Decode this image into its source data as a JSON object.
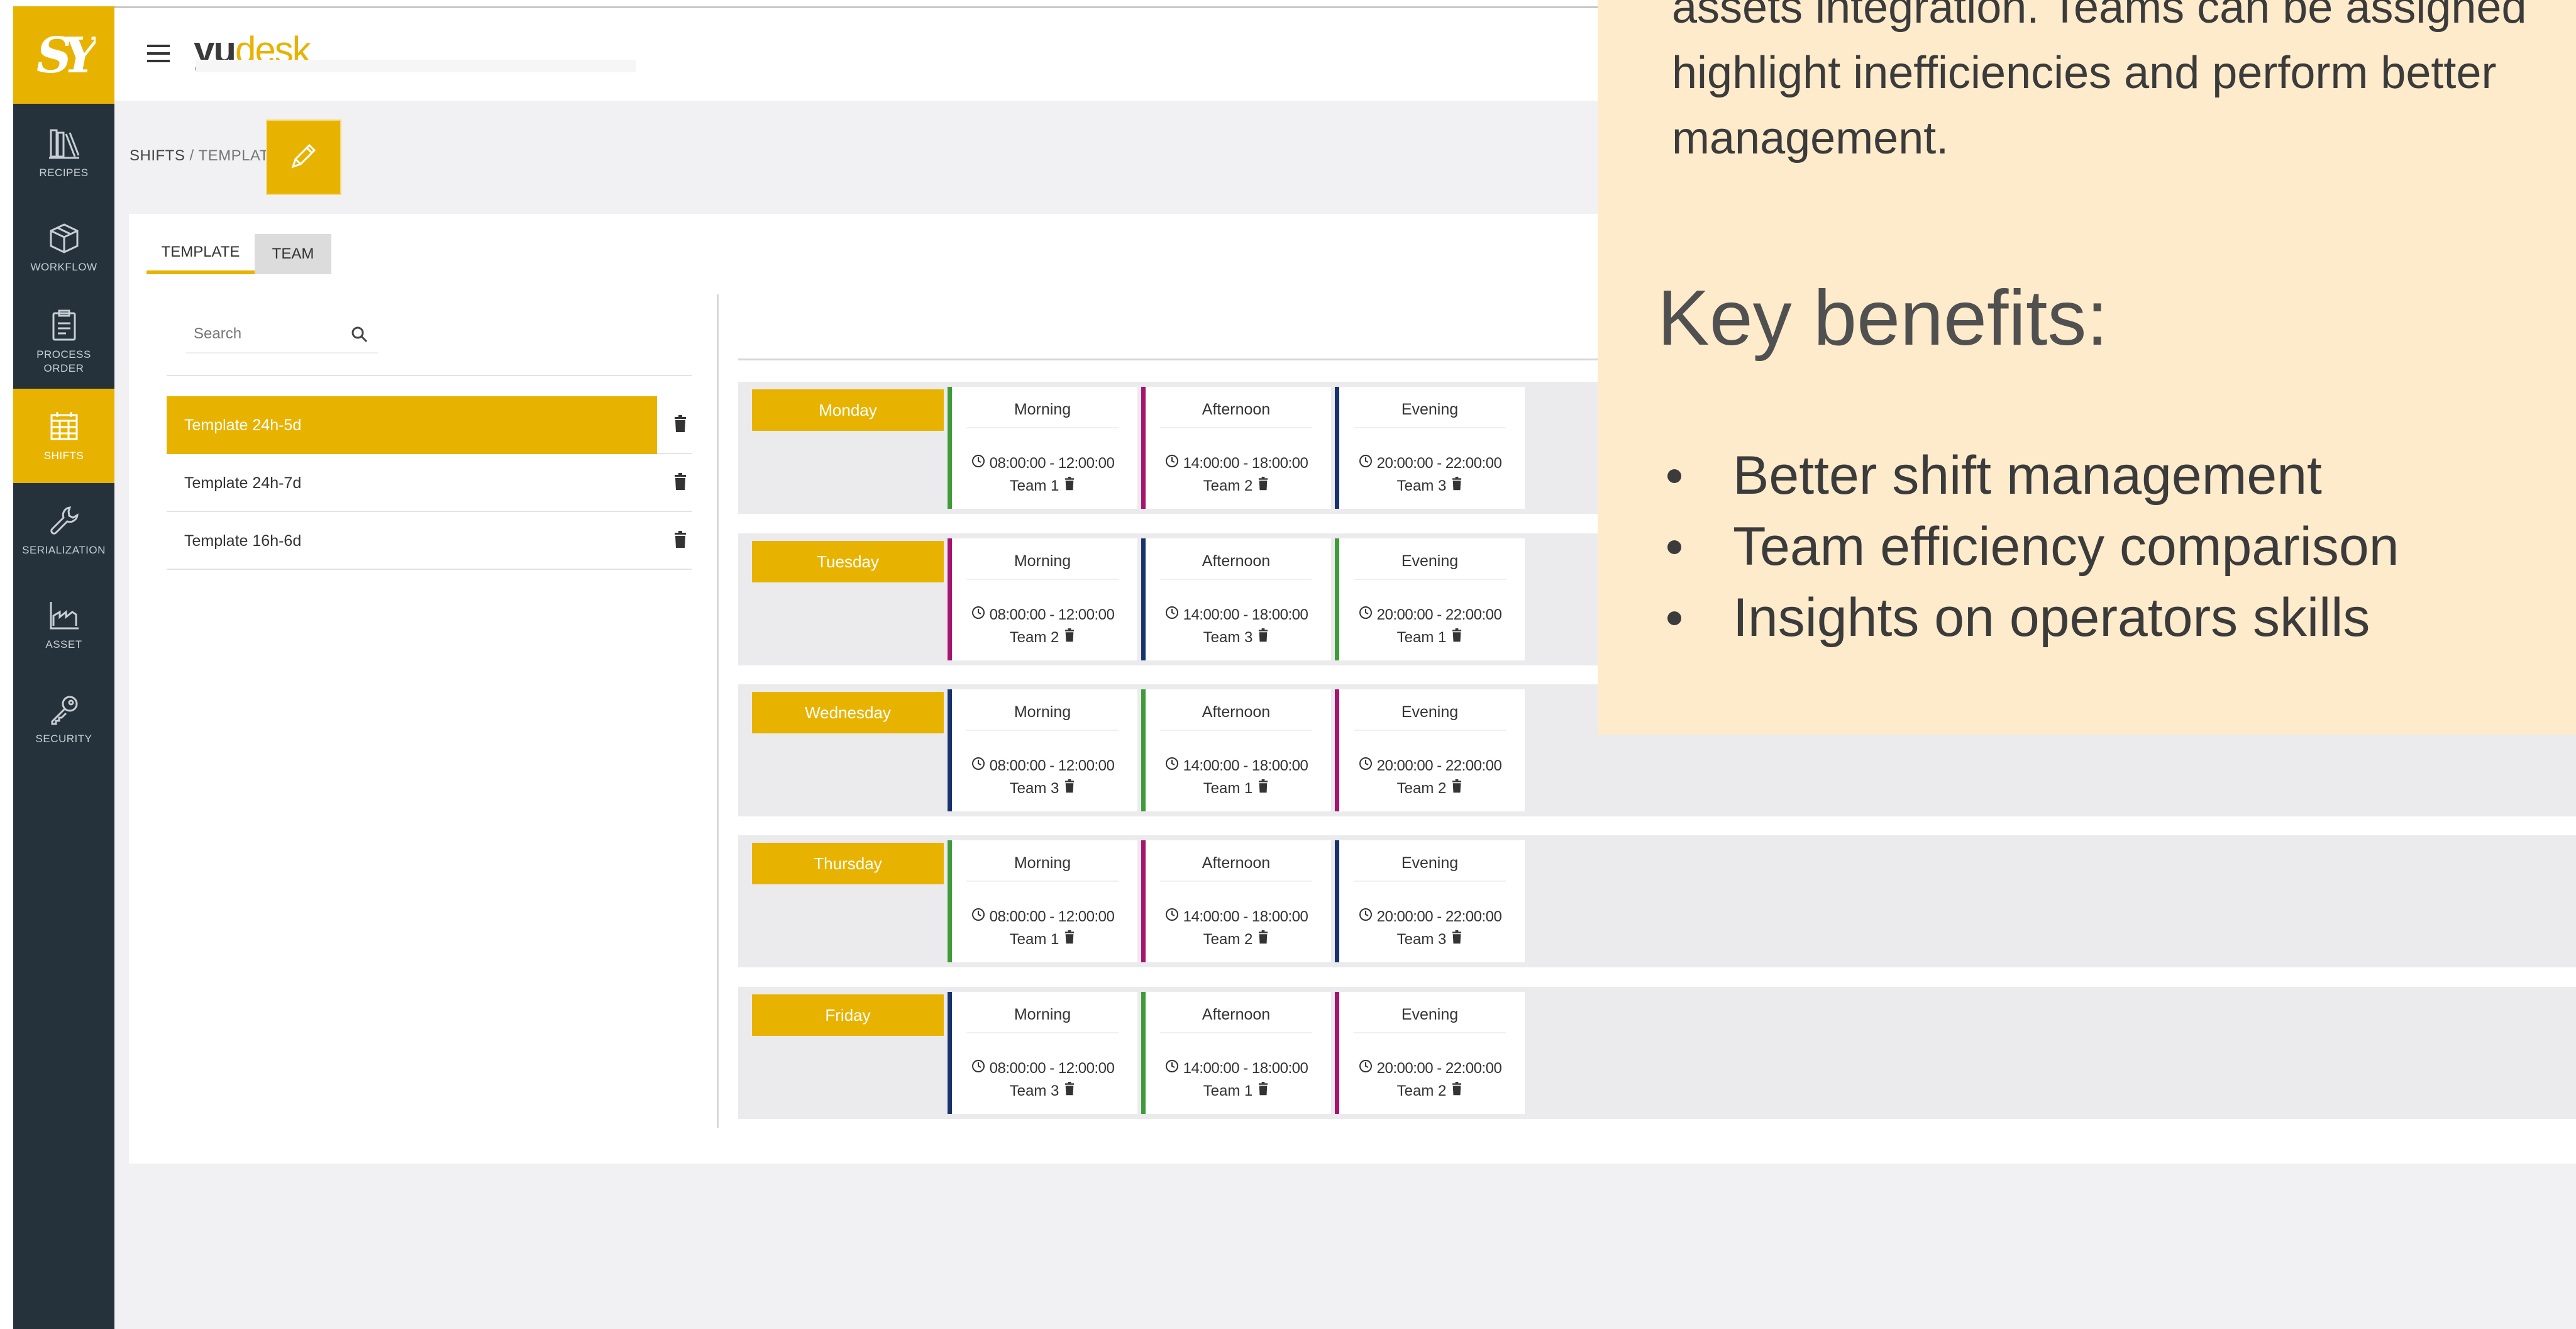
{
  "sidebar": {
    "logo_glyph": "SY",
    "items": [
      {
        "label": "RECIPES",
        "icon": "books-icon"
      },
      {
        "label": "WORKFLOW",
        "icon": "cube-icon"
      },
      {
        "label": "PROCESS\nORDER",
        "icon": "clipboard-icon"
      },
      {
        "label": "SHIFTS",
        "icon": "calendar-grid-icon"
      },
      {
        "label": "SERIALIZATION",
        "icon": "wrench-icon"
      },
      {
        "label": "ASSET",
        "icon": "factory-icon"
      },
      {
        "label": "SECURITY",
        "icon": "key-icon"
      }
    ]
  },
  "topbar": {
    "brand_yu": "yu",
    "brand_desk": "desk"
  },
  "breadcrumb": {
    "section": "SHIFTS",
    "separator": " / ",
    "page": "TEMPLATE"
  },
  "tabs": {
    "template": "TEMPLATE",
    "team": "TEAM"
  },
  "search": {
    "placeholder": "Search"
  },
  "templates": [
    "Template 24h-5d",
    "Template 24h-7d",
    "Template 16h-6d"
  ],
  "days": [
    {
      "day": "Monday",
      "shifts": [
        {
          "name": "Morning",
          "time": "08:00:00 - 12:00:00",
          "team": "Team 1"
        },
        {
          "name": "Afternoon",
          "time": "14:00:00 - 18:00:00",
          "team": "Team 2"
        },
        {
          "name": "Evening",
          "time": "20:00:00 - 22:00:00",
          "team": "Team 3"
        }
      ]
    },
    {
      "day": "Tuesday",
      "shifts": [
        {
          "name": "Morning",
          "time": "08:00:00 - 12:00:00",
          "team": "Team 2"
        },
        {
          "name": "Afternoon",
          "time": "14:00:00 - 18:00:00",
          "team": "Team 3"
        },
        {
          "name": "Evening",
          "time": "20:00:00 - 22:00:00",
          "team": "Team 1"
        }
      ]
    },
    {
      "day": "Wednesday",
      "shifts": [
        {
          "name": "Morning",
          "time": "08:00:00 - 12:00:00",
          "team": "Team 3"
        },
        {
          "name": "Afternoon",
          "time": "14:00:00 - 18:00:00",
          "team": "Team 1"
        },
        {
          "name": "Evening",
          "time": "20:00:00 - 22:00:00",
          "team": "Team 2"
        }
      ]
    },
    {
      "day": "Thursday",
      "shifts": [
        {
          "name": "Morning",
          "time": "08:00:00 - 12:00:00",
          "team": "Team 1"
        },
        {
          "name": "Afternoon",
          "time": "14:00:00 - 18:00:00",
          "team": "Team 2"
        },
        {
          "name": "Evening",
          "time": "20:00:00 - 22:00:00",
          "team": "Team 3"
        }
      ]
    },
    {
      "day": "Friday",
      "shifts": [
        {
          "name": "Morning",
          "time": "08:00:00 - 12:00:00",
          "team": "Team 3"
        },
        {
          "name": "Afternoon",
          "time": "14:00:00 - 18:00:00",
          "team": "Team 1"
        },
        {
          "name": "Evening",
          "time": "20:00:00 - 22:00:00",
          "team": "Team 2"
        }
      ]
    }
  ],
  "team_colors": {
    "Team 1": "#3f9b3a",
    "Team 2": "#a5146e",
    "Team 3": "#16346b"
  },
  "colors": {
    "accent": "#e8b300",
    "sidebar": "#25323b",
    "note_bg": "#fdebcb"
  },
  "note": {
    "paragraph": "assets integration. Teams can be assigned\nhighlight inefficiencies and perform better\nmanagement.",
    "heading": "Key benefits:",
    "benefits": [
      "Better shift management",
      "Team efficiency comparison",
      "Insights on operators skills"
    ]
  }
}
